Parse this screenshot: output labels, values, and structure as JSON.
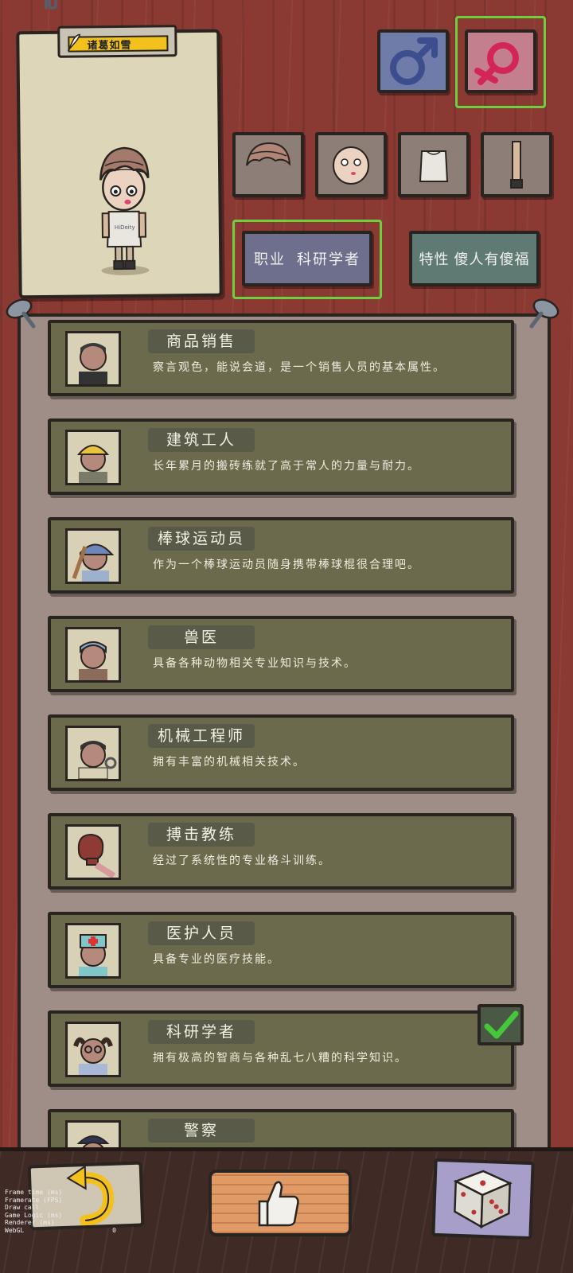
{
  "character": {
    "name": "诸葛如雪",
    "shirt_text": "HiDeity"
  },
  "gender": {
    "male_symbol": "♂",
    "female_selected": true
  },
  "job_button": {
    "label": "职业",
    "value": "科研学者"
  },
  "trait_button": {
    "label": "特性",
    "value": "傻人有傻福"
  },
  "jobs": [
    {
      "title": "商品销售",
      "description": "察言观色，能说会道，是一个销售人员的基本属性。",
      "icon": "salesman-avatar-icon"
    },
    {
      "title": "建筑工人",
      "description": "长年累月的搬砖练就了高于常人的力量与耐力。",
      "icon": "construction-worker-avatar-icon"
    },
    {
      "title": "棒球运动员",
      "description": "作为一个棒球运动员随身携带棒球棍很合理吧。",
      "icon": "baseball-player-avatar-icon"
    },
    {
      "title": "兽医",
      "description": "具备各种动物相关专业知识与技术。",
      "icon": "vet-avatar-icon"
    },
    {
      "title": "机械工程师",
      "description": "拥有丰富的机械相关技术。",
      "icon": "mechanic-avatar-icon"
    },
    {
      "title": "搏击教练",
      "description": "经过了系统性的专业格斗训练。",
      "icon": "boxing-glove-icon"
    },
    {
      "title": "医护人员",
      "description": "具备专业的医疗技能。",
      "icon": "medic-avatar-icon"
    },
    {
      "title": "科研学者",
      "description": "拥有极高的智商与各种乱七八糟的科学知识。",
      "icon": "scientist-avatar-icon",
      "selected": true
    },
    {
      "title": "警察",
      "description": "",
      "icon": "police-avatar-icon"
    }
  ],
  "debug": [
    {
      "label": "Frame time (ms)",
      "value": ""
    },
    {
      "label": "Framerate (FPS)",
      "value": ""
    },
    {
      "label": "Draw call",
      "value": ""
    },
    {
      "label": "Game Logic (ms)",
      "value": ""
    },
    {
      "label": "Renderer (ms)",
      "value": ""
    },
    {
      "label": "WebGL",
      "value": "0"
    }
  ],
  "colors": {
    "select_green": "#6fcf3f",
    "card_olive": "#6c6a4c",
    "background_red": "#8a3a33"
  }
}
